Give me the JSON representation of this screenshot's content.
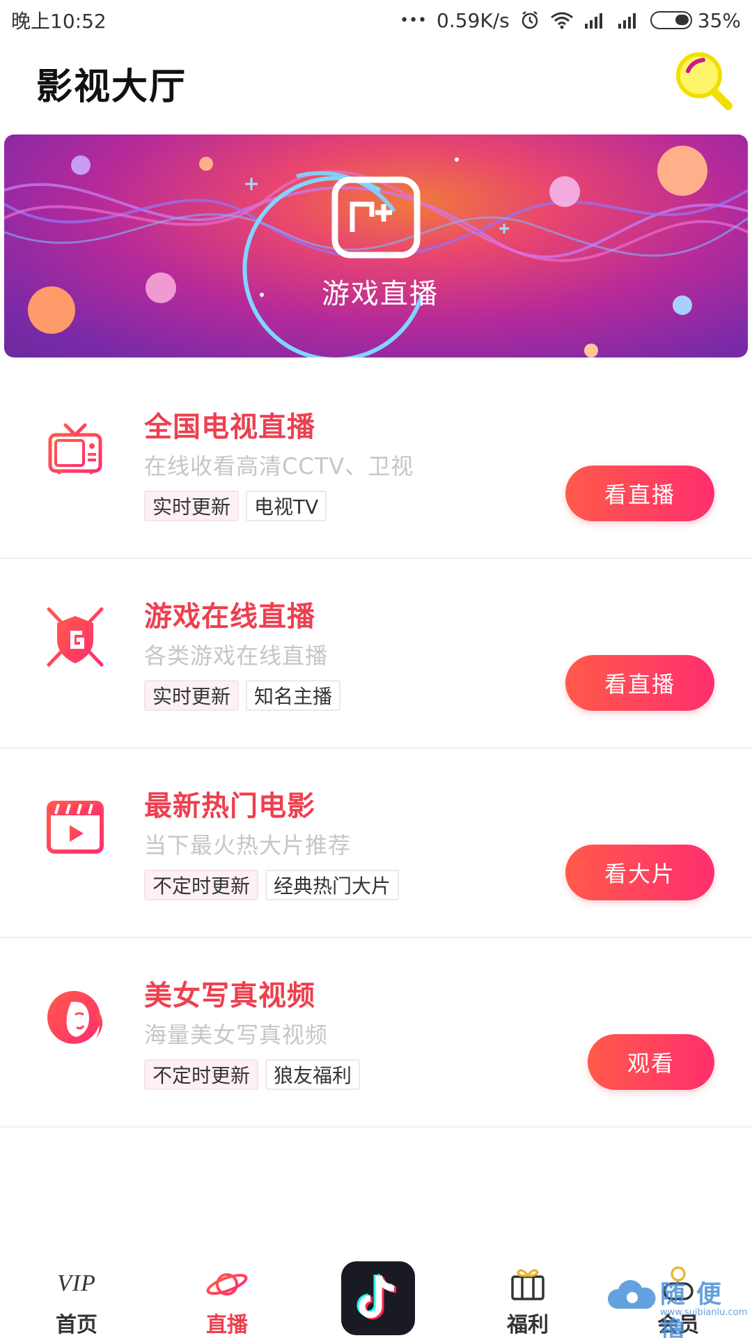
{
  "status_bar": {
    "time": "晚上10:52",
    "dots": "•••",
    "speed": "0.59K/s",
    "battery": "35%",
    "battery_level": 0.35
  },
  "header": {
    "title": "影视大厅"
  },
  "banner": {
    "label": "游戏直播"
  },
  "items": [
    {
      "title": "全国电视直播",
      "subtitle": "在线收看高清CCTV、卫视",
      "tags": [
        "实时更新",
        "电视TV"
      ],
      "button": "看直播",
      "icon": "tv-icon"
    },
    {
      "title": "游戏在线直播",
      "subtitle": "各类游戏在线直播",
      "tags": [
        "实时更新",
        "知名主播"
      ],
      "button": "看直播",
      "icon": "game-shield-icon"
    },
    {
      "title": "最新热门电影",
      "subtitle": "当下最火热大片推荐",
      "tags": [
        "不定时更新",
        "经典热门大片"
      ],
      "button": "看大片",
      "icon": "movie-clapper-icon"
    },
    {
      "title": "美女写真视频",
      "subtitle": "海量美女写真视频",
      "tags": [
        "不定时更新",
        "狼友福利"
      ],
      "button": "观看",
      "icon": "woman-face-icon"
    }
  ],
  "nav": {
    "home": "首页",
    "live": "直播",
    "center_icon": "tiktok-icon",
    "welfare": "福利",
    "member": "会员",
    "vip_text": "VIP"
  },
  "watermark": {
    "text": "随便撸",
    "url": "www.suibianlu.com"
  },
  "colors": {
    "accent": "#ee3f4f",
    "button_start": "#ff5a4a",
    "button_end": "#ff2e6e",
    "banner_purple": "#7a2aa8"
  }
}
